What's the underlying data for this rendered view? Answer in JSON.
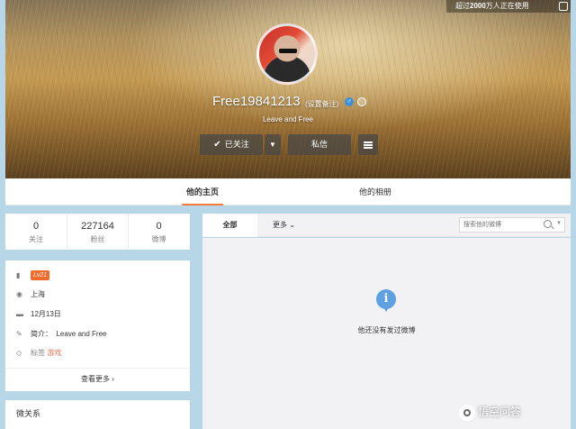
{
  "header": {
    "online_notice_prefix": "超过",
    "online_notice_count": "2000",
    "online_notice_suffix": "万人正在使用",
    "username": "Free19841213",
    "remark_link": "(设置备注)",
    "gender": "♂",
    "motto": "Leave and Free",
    "follow_label": "已关注",
    "message_label": "私信"
  },
  "tabs": [
    {
      "label": "他的主页",
      "active": true
    },
    {
      "label": "他的相册",
      "active": false
    }
  ],
  "stats": [
    {
      "value": "0",
      "label": "关注"
    },
    {
      "value": "227164",
      "label": "粉丝"
    },
    {
      "value": "0",
      "label": "微博"
    }
  ],
  "info": {
    "level": "Lv21",
    "location": "上海",
    "birthday": "12月13日",
    "bio_label": "简介：",
    "bio": "Leave and Free",
    "tags_label": "标签",
    "tags": "游戏",
    "see_more": "查看更多 ›"
  },
  "relations": {
    "title": "微关系"
  },
  "feed": {
    "tab_all": "全部",
    "tab_more": "更多 ⌄",
    "search_placeholder": "搜索他的微博",
    "empty_text": "他还没有发过微博",
    "empty_icon": "i"
  },
  "watermark": "悟空问答",
  "colors": {
    "accent": "#fa7d3c",
    "info_icon": "#5ea0e0",
    "page_bg": "#b7d6e8",
    "level_badge": "#f06a2a"
  }
}
